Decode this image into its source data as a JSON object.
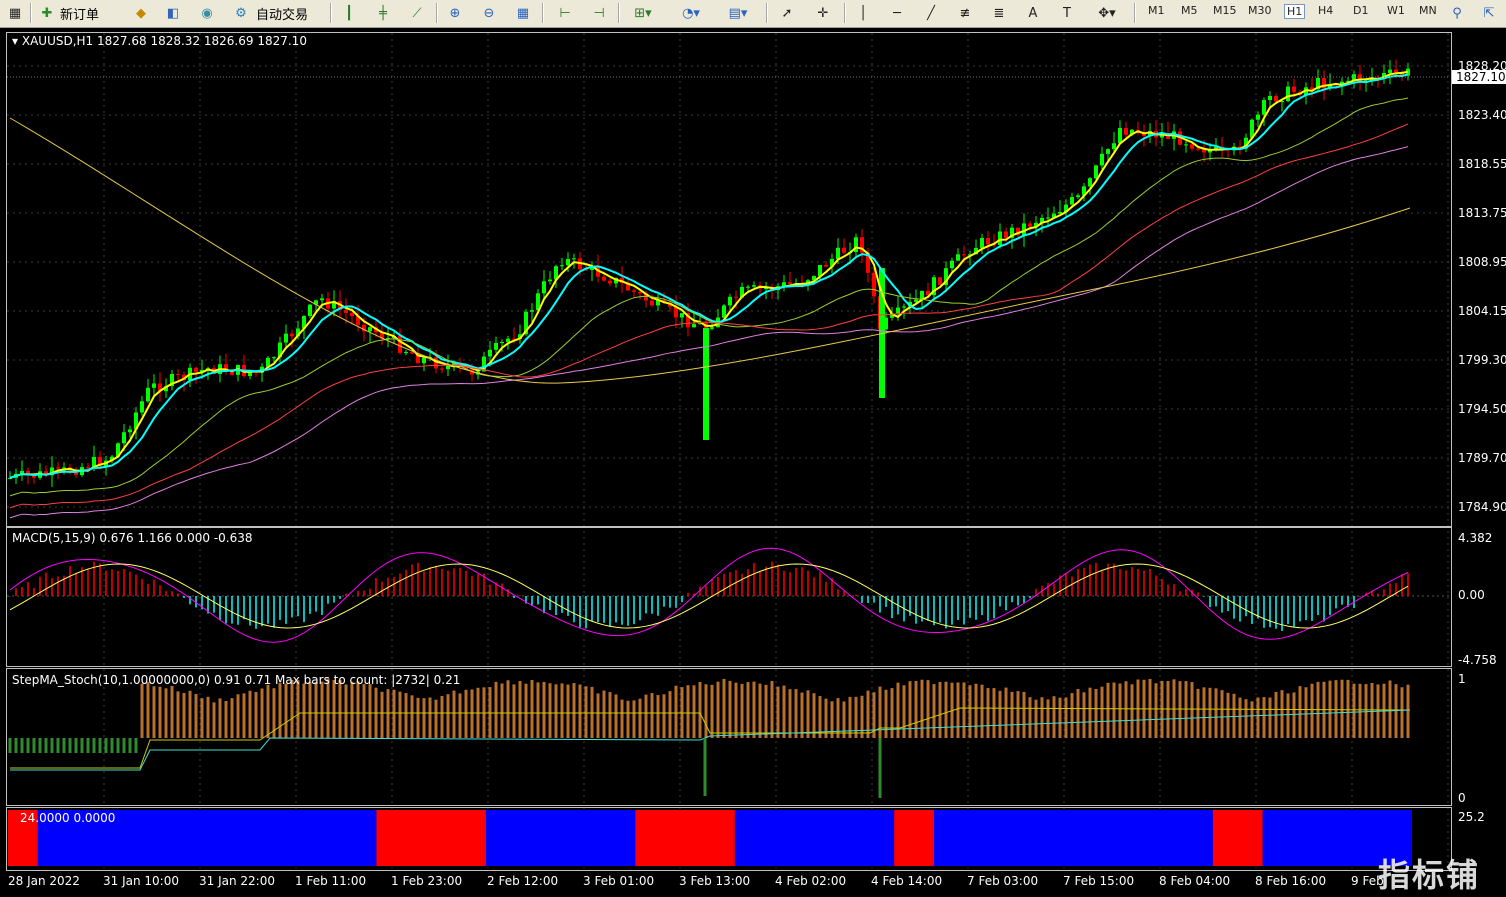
{
  "toolbar": {
    "new_order_label": "新订单",
    "auto_trade_label": "自动交易",
    "timeframes": [
      "M1",
      "M5",
      "M15",
      "M30",
      "H1",
      "H4",
      "D1",
      "W1",
      "MN"
    ],
    "active_timeframe": "H1"
  },
  "chart_header": {
    "symbol": "XAUUSD,H1",
    "ohlc": "1827.68 1828.32 1826.69 1827.10"
  },
  "current_price": "1827.10",
  "price_axis": [
    "1828.20",
    "1823.40",
    "1818.55",
    "1813.75",
    "1808.95",
    "1804.15",
    "1799.30",
    "1794.50",
    "1789.70",
    "1784.90"
  ],
  "macd": {
    "label": "MACD(5,15,9) 0.676 1.166 0.000 -0.638",
    "axis": [
      "4.382",
      "0.00",
      "-4.758"
    ]
  },
  "stepma": {
    "label": "StepMA_Stoch(10,1.00000000,0) 0.91 0.71  Max bars to count: |2732|   0.21",
    "axis": [
      "1",
      "0"
    ]
  },
  "bottom_indicator": {
    "label": "24.0000 0.0000",
    "axis": [
      "25.2"
    ],
    "colors": {
      "up": "#0000ff",
      "down": "#ff0000"
    },
    "segments": [
      {
        "state": "down",
        "span": [
          0,
          3
        ]
      },
      {
        "state": "up",
        "span": [
          3,
          37
        ]
      },
      {
        "state": "down",
        "span": [
          37,
          48
        ]
      },
      {
        "state": "up",
        "span": [
          48,
          63
        ]
      },
      {
        "state": "down",
        "span": [
          63,
          73
        ]
      },
      {
        "state": "up",
        "span": [
          73,
          89
        ]
      },
      {
        "state": "down",
        "span": [
          89,
          93
        ]
      },
      {
        "state": "up",
        "span": [
          93,
          121
        ]
      },
      {
        "state": "down",
        "span": [
          121,
          126
        ]
      },
      {
        "state": "up",
        "span": [
          126,
          141
        ]
      }
    ]
  },
  "time_axis": [
    "28 Jan 2022",
    "31 Jan 10:00",
    "31 Jan 22:00",
    "1 Feb 11:00",
    "1 Feb 23:00",
    "2 Feb 12:00",
    "3 Feb 01:00",
    "3 Feb 13:00",
    "4 Feb 02:00",
    "4 Feb 14:00",
    "7 Feb 03:00",
    "7 Feb 15:00",
    "8 Feb 04:00",
    "8 Feb 16:00",
    "9 Feb"
  ],
  "watermark": "指标铺",
  "colors": {
    "background": "#000000",
    "bull_candle": "#00ff00",
    "bear_candle": "#ff0000",
    "ma_fast": "#ffff00",
    "ma_mid": "#00ffff",
    "macd_hist_pos": "#ff0000",
    "macd_hist_neg": "#00ffff",
    "macd_main": "#ff00ff",
    "macd_signal": "#ffff66",
    "stoch_hist": "#b8702f"
  }
}
